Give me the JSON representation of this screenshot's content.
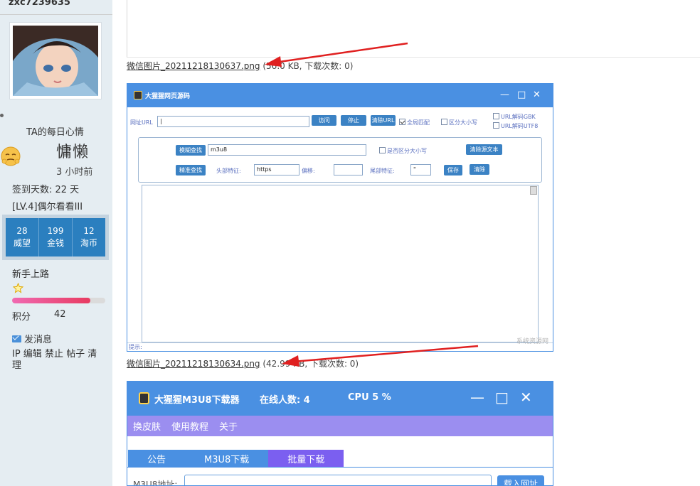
{
  "sidebar": {
    "username": "zxc7239635",
    "mood_label": "TA的每日心情",
    "mood_word": "慵懒",
    "mood_time": "3 小时前",
    "signin": "签到天数: 22 天",
    "level": "[LV.4]偶尔看看III",
    "stats": [
      {
        "value": "28",
        "label": "威望"
      },
      {
        "value": "199",
        "label": "金钱"
      },
      {
        "value": "12",
        "label": "淘币"
      }
    ],
    "rank": "新手上路",
    "progress_fraction": 0.84,
    "points_label": "积分",
    "points_value": "42",
    "pm_label": "发消息",
    "ip_actions": "IP 编辑 禁止 帖子 清理"
  },
  "attachments": [
    {
      "filename": "微信图片_20211218130637.png",
      "meta": " (56.0 KB, 下载次数: 0)"
    },
    {
      "filename": "微信图片_20211218130634.png",
      "meta": " (42.99 KB, 下载次数: 0)"
    }
  ],
  "shot1": {
    "title": "大猩猩网页源码",
    "url_label": "网址URL",
    "url_value": "|",
    "visit_btn": "访问",
    "stop_btn": "停止",
    "clear_url_btn": "清除URL",
    "full_match": "全局匹配",
    "case_sensitive": "区分大小写",
    "url_gbk": "URL解码GBK",
    "url_utf8": "URL解码UTF8",
    "fuzzy_btn": "模糊查找",
    "fuzzy_value": "m3u8",
    "case_opt": "是否区分大小写",
    "clear_src_btn": "清除源文本",
    "exact_btn": "精准查找",
    "head_label": "头部特征:",
    "head_value": "https",
    "offset_label": "偏移:",
    "tail_label": "尾部特征:",
    "tail_value": "\"",
    "save_btn": "保存",
    "clear_btn": "清除",
    "status_label": "提示:",
    "watermark": "系统资源网"
  },
  "shot2": {
    "title": "大猩猩M3U8下载器",
    "online": "在线人数: 4",
    "cpu": "CPU  5  %",
    "menu": [
      "换皮肤",
      "使用教程",
      "关于"
    ],
    "tabs": [
      "公告",
      "M3U8下载",
      "批量下载"
    ],
    "url_label": "M3U8地址:",
    "load_btn": "载入网址"
  },
  "colors": {
    "sidebar_bg": "#e5edf2",
    "stats_bg": "#2b7fbf",
    "window_blue": "#4a90e2",
    "menu_purple": "#9b8ef0",
    "arrow_red": "#e02020"
  }
}
